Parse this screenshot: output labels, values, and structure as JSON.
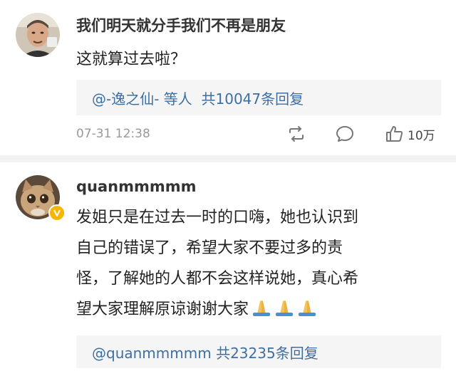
{
  "comments": [
    {
      "username": "我们明天就分手我们不再是朋友",
      "text": "这就算过去啦？",
      "reply_summary": "@-逸之仙- 等人  共10047条回复",
      "date": "07-31 12:38",
      "likes": "10万",
      "avatar": "avatar-man-photo",
      "verified": false
    },
    {
      "username": "quanmmmmm",
      "text_lines": [
        "发姐只是在过去一时的口嗨，她也认识到",
        "自己的错误了，希望大家不要过多的责",
        "怪，了解她的人都不会这样说她，真心希",
        "望大家理解原谅谢谢大家"
      ],
      "reply_summary": "@quanmmmmm 共23235条回复",
      "avatar": "avatar-cat-photo",
      "verified": true
    }
  ],
  "icons": {
    "share": "repost-icon",
    "comment": "comment-icon",
    "like": "thumbs-up-icon",
    "pray": "folded-hands-emoji"
  },
  "colors": {
    "link": "#3f6ea3",
    "reply_bg": "#f5f5f5",
    "badge": "#f7b500",
    "divider": "#f2f2f2"
  }
}
